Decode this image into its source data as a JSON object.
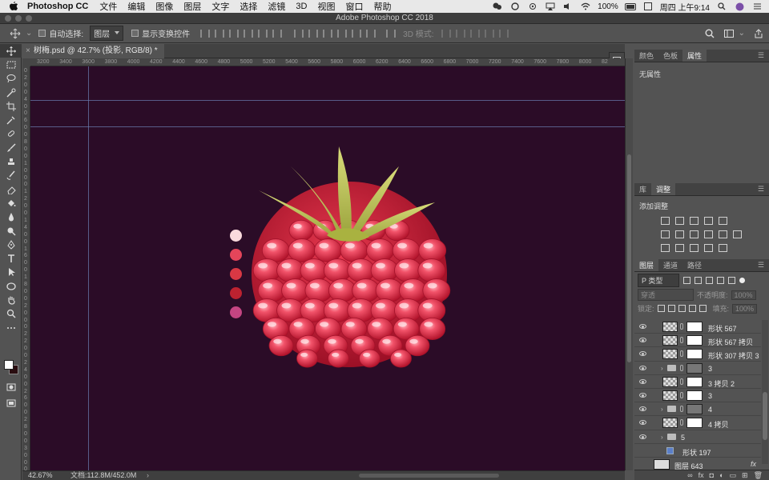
{
  "menubar": {
    "app": "Photoshop CC",
    "items": [
      "文件",
      "编辑",
      "图像",
      "图层",
      "文字",
      "选择",
      "滤镜",
      "3D",
      "视图",
      "窗口",
      "帮助"
    ],
    "battery": "100%",
    "clock": "周四 上午9:14"
  },
  "window": {
    "title": "Adobe Photoshop CC 2018"
  },
  "options": {
    "auto_select_label": "自动选择:",
    "auto_select_value": "图层",
    "show_transform_label": "显示变换控件",
    "mode_3d_label": "3D 模式:"
  },
  "document": {
    "tab_title": "树梅.psd @ 42.7% (投影, RGB/8) *",
    "close_glyph": "×"
  },
  "ruler": {
    "h_ticks": [
      "3200",
      "3400",
      "3600",
      "3800",
      "4000",
      "4200",
      "4400",
      "4600",
      "4800",
      "5000",
      "5200",
      "5400",
      "5600",
      "5800",
      "6000",
      "6200",
      "6400",
      "6600",
      "6800",
      "7000",
      "7200",
      "7400",
      "7600",
      "7800",
      "8000",
      "82"
    ],
    "v_ticks": [
      "0",
      "2",
      "0",
      "0",
      "4",
      "0",
      "0",
      "6",
      "0",
      "0",
      "8",
      "0",
      "0",
      "1",
      "0",
      "0",
      "0",
      "1",
      "2",
      "0",
      "0",
      "1",
      "4",
      "0",
      "0",
      "1",
      "6",
      "0",
      "0",
      "1",
      "8",
      "0",
      "0",
      "2",
      "0",
      "0",
      "0",
      "2",
      "2",
      "0",
      "0",
      "2",
      "4",
      "0",
      "0",
      "2",
      "6",
      "0",
      "0",
      "2",
      "8",
      "0",
      "0",
      "3",
      "0",
      "0",
      "0"
    ]
  },
  "canvas": {
    "background": "#2b0c27",
    "swatches": [
      "#fadadd",
      "#e4455a",
      "#d93844",
      "#bc2230",
      "#c44582"
    ]
  },
  "status": {
    "zoom": "42.67%",
    "doc_info": "文档:112.8M/452.0M",
    "arrow": "›"
  },
  "panels": {
    "props_tabs": [
      "颜色",
      "色板",
      "属性"
    ],
    "props_active": 2,
    "props_empty": "无属性",
    "adj_tabs": [
      "库",
      "调整"
    ],
    "adj_active": 1,
    "adj_title": "添加调整",
    "layers_tabs": [
      "图层",
      "通道",
      "路径"
    ],
    "layers_active": 0,
    "layer_filter": "P 类型",
    "blend_mode": "穿透",
    "opacity_label": "不透明度:",
    "opacity_value": "100%",
    "lock_label": "锁定:",
    "fill_label": "填充:",
    "fill_value": "100%"
  },
  "layers": [
    {
      "name": "形状 567",
      "kind": "shape"
    },
    {
      "name": "形状 567 拷贝",
      "kind": "shape"
    },
    {
      "name": "形状 307 拷贝 3",
      "kind": "shape"
    },
    {
      "name": "3",
      "kind": "group"
    },
    {
      "name": "3 拷贝 2",
      "kind": "shape"
    },
    {
      "name": "3",
      "kind": "shape"
    },
    {
      "name": "4",
      "kind": "group"
    },
    {
      "name": "4 拷贝",
      "kind": "shape"
    },
    {
      "name": "5",
      "kind": "group-plain"
    },
    {
      "name": "形状 197",
      "kind": "smallshape"
    },
    {
      "name": "图层 643",
      "kind": "pixel"
    }
  ],
  "icons": {
    "fx": "fx"
  }
}
